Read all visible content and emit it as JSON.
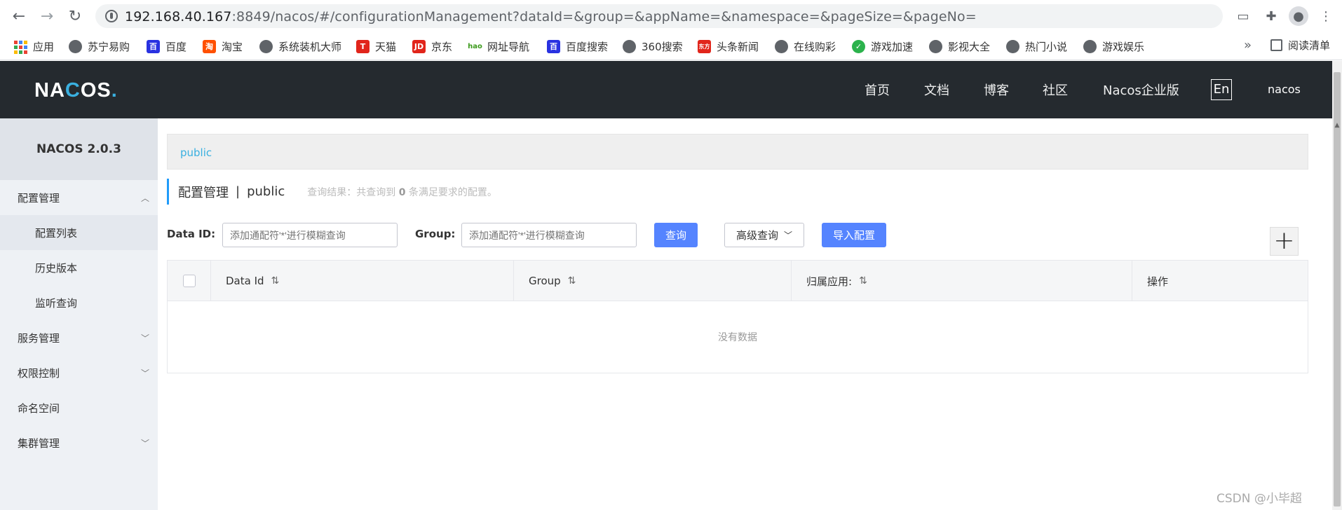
{
  "browser": {
    "url_host": "192.168.40.167",
    "url_rest": ":8849/nacos/#/configurationManagement?dataId=&group=&appName=&namespace=&pageSize=&pageNo=",
    "bookmarks": [
      {
        "label": "应用",
        "icon": "apps-grid-icon"
      },
      {
        "label": "苏宁易购",
        "icon": "globe-icon"
      },
      {
        "label": "百度",
        "icon": "baidu-paw-icon"
      },
      {
        "label": "淘宝",
        "icon": "taobao-icon"
      },
      {
        "label": "系统装机大师",
        "icon": "globe-icon"
      },
      {
        "label": "天猫",
        "icon": "tmall-icon"
      },
      {
        "label": "京东",
        "icon": "jd-icon"
      },
      {
        "label": "网址导航",
        "icon": "hao-icon"
      },
      {
        "label": "百度搜索",
        "icon": "baidu-paw-icon"
      },
      {
        "label": "360搜索",
        "icon": "globe-icon"
      },
      {
        "label": "头条新闻",
        "icon": "toutiao-icon"
      },
      {
        "label": "在线购彩",
        "icon": "globe-icon"
      },
      {
        "label": "游戏加速",
        "icon": "game-accel-icon"
      },
      {
        "label": "影视大全",
        "icon": "globe-icon"
      },
      {
        "label": "热门小说",
        "icon": "globe-icon"
      },
      {
        "label": "游戏娱乐",
        "icon": "globe-icon"
      }
    ],
    "more": "»",
    "reading_list": "阅读清单"
  },
  "header": {
    "logo": "NACOS.",
    "nav": [
      "首页",
      "文档",
      "博客",
      "社区",
      "Nacos企业版"
    ],
    "lang": "En",
    "user": "nacos"
  },
  "sidebar": {
    "version": "NACOS 2.0.3",
    "items": [
      {
        "label": "配置管理",
        "expanded": true
      },
      {
        "label": "配置列表",
        "sub": true,
        "active": true
      },
      {
        "label": "历史版本",
        "sub": true
      },
      {
        "label": "监听查询",
        "sub": true
      },
      {
        "label": "服务管理",
        "expanded": false
      },
      {
        "label": "权限控制",
        "expanded": false
      },
      {
        "label": "命名空间"
      },
      {
        "label": "集群管理",
        "expanded": false
      }
    ]
  },
  "main": {
    "namespace": "public",
    "title": "配置管理",
    "title_sep": "|",
    "title_ns": "public",
    "result_prefix": "查询结果：共查询到",
    "result_count": "0",
    "result_suffix": "条满足要求的配置。",
    "dataid_label": "Data ID:",
    "dataid_placeholder": "添加通配符'*'进行模糊查询",
    "group_label": "Group:",
    "group_placeholder": "添加通配符'*'进行模糊查询",
    "query_button": "查询",
    "advanced_button": "高级查询",
    "import_button": "导入配置",
    "add_button": "+",
    "table": {
      "columns": [
        "Data Id",
        "Group",
        "归属应用:",
        "操作"
      ],
      "empty_text": "没有数据"
    }
  },
  "watermark": "CSDN @小毕超",
  "colors": {
    "topbar": "#252a2f",
    "accent": "#3ab0e0",
    "primary_button": "#5584ff",
    "sidebar_bg": "#eef1f5"
  }
}
